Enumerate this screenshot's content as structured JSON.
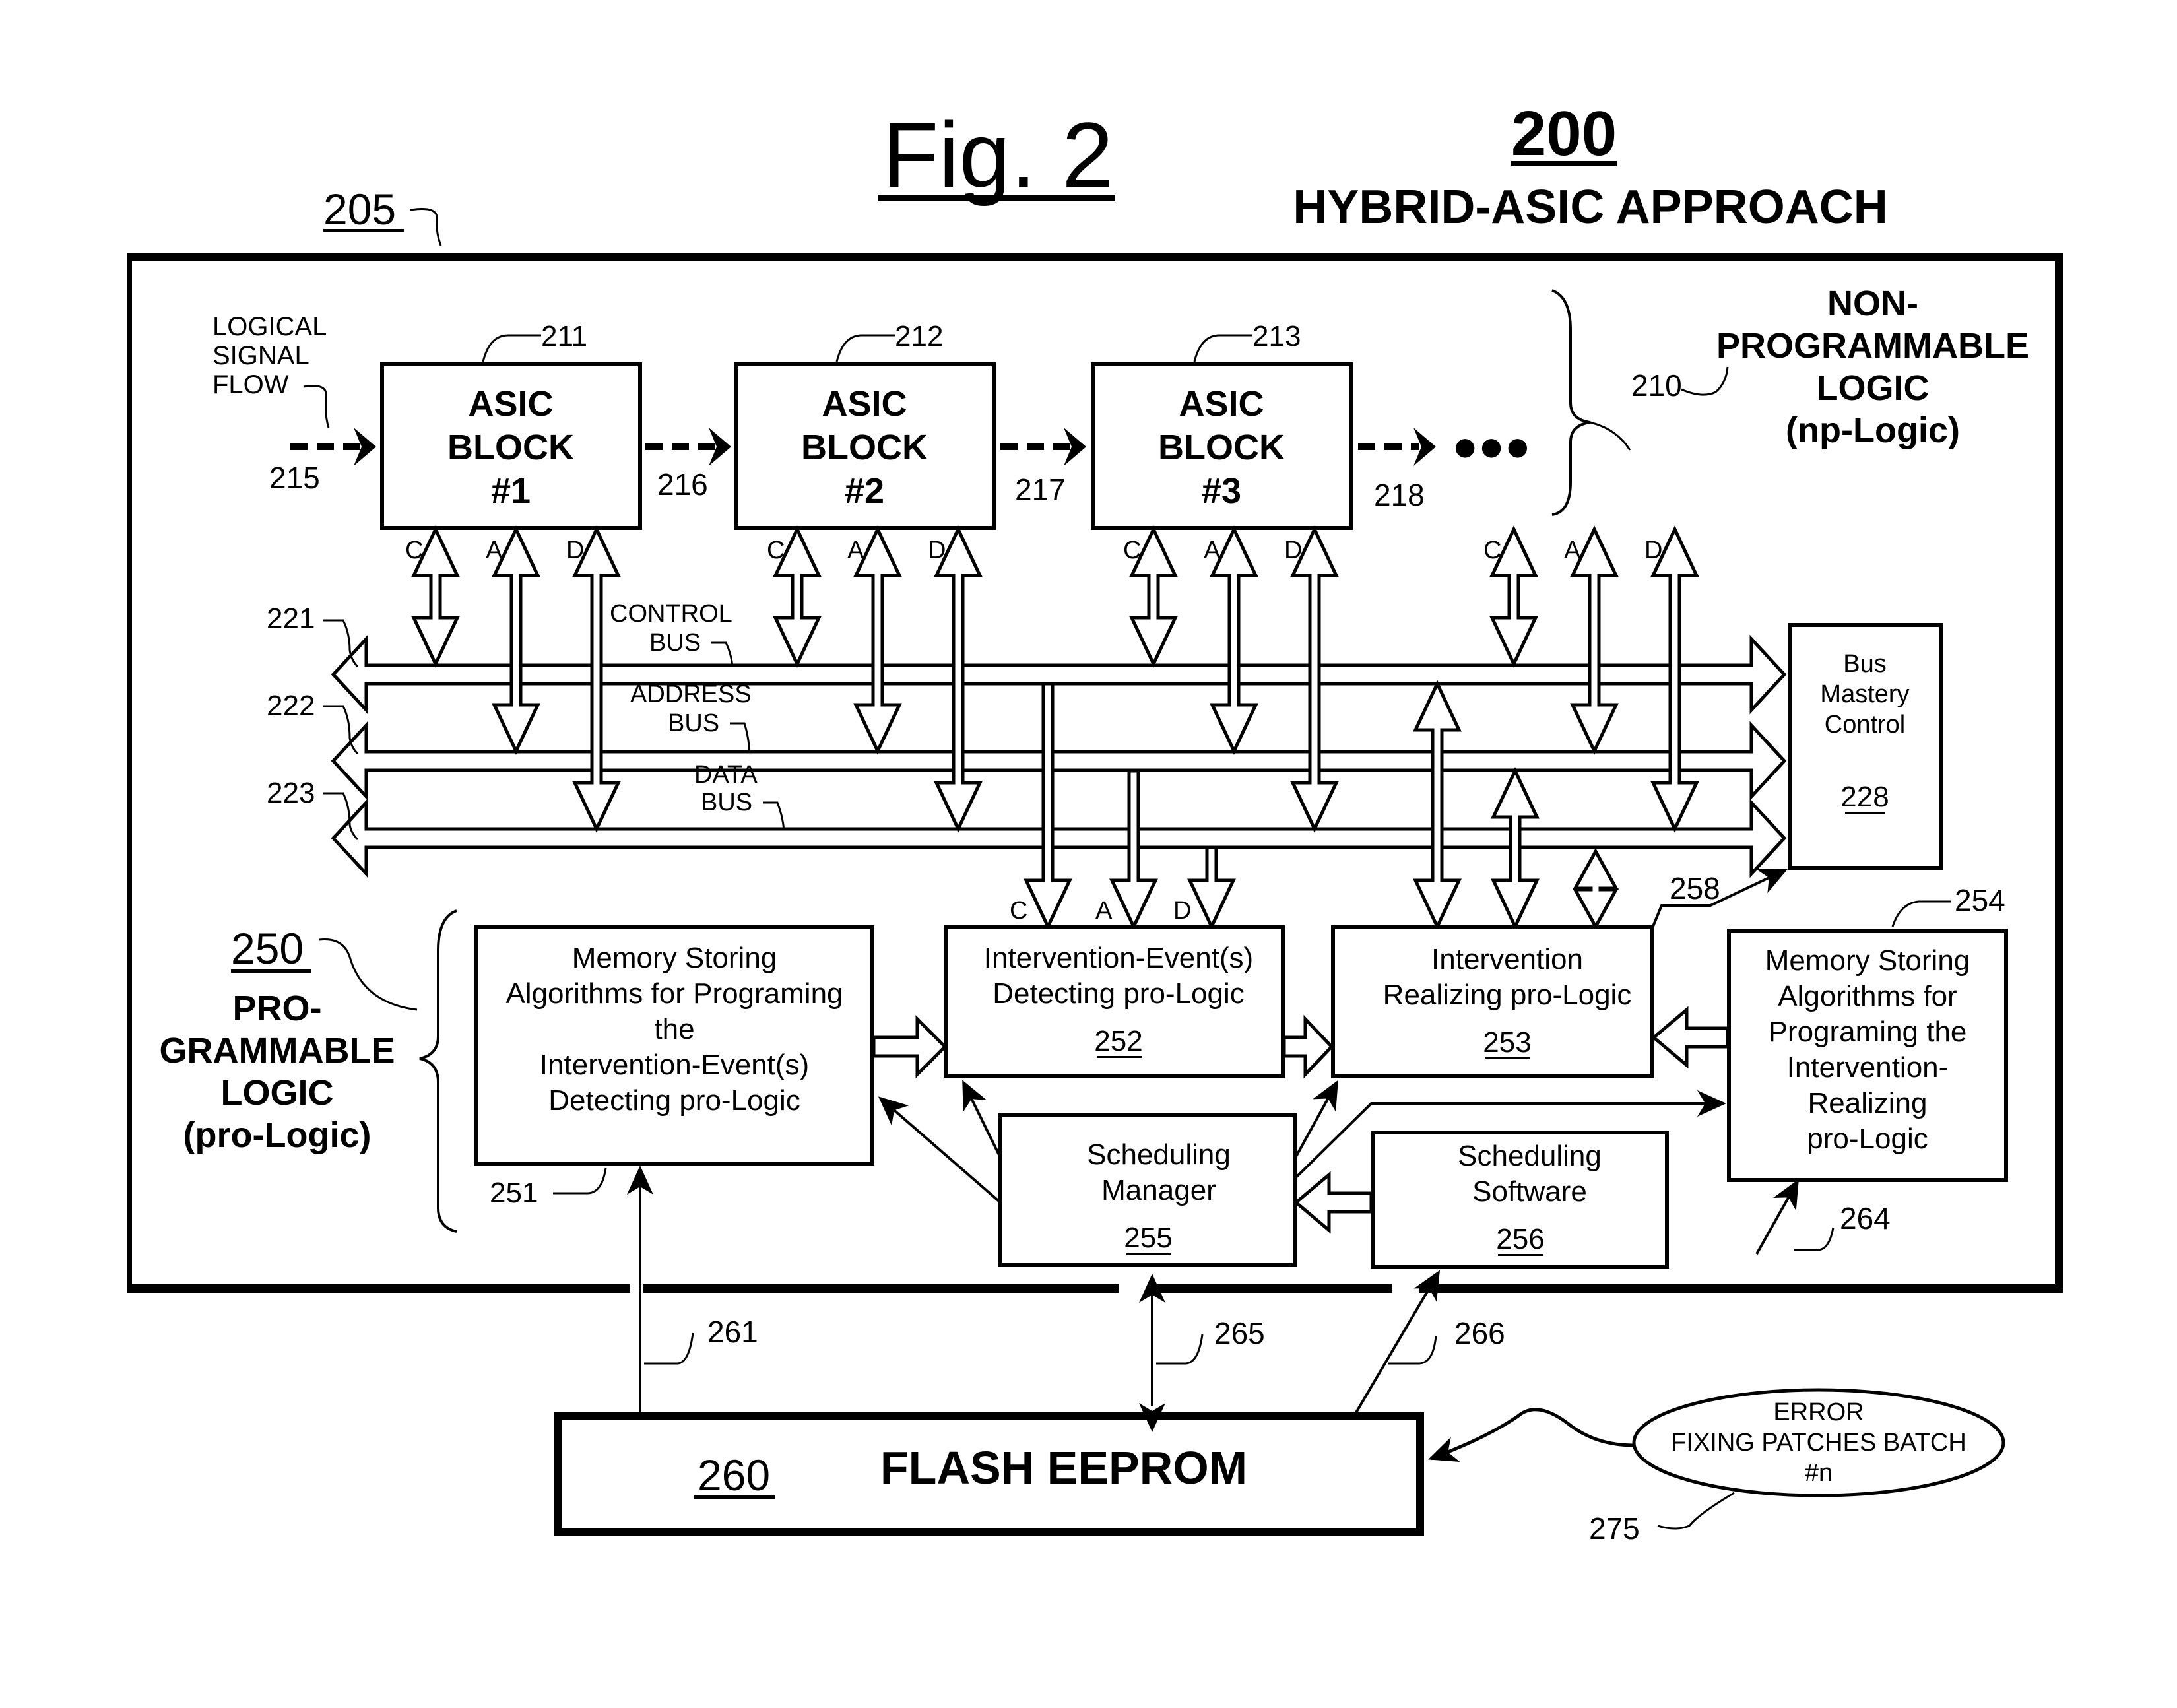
{
  "figure": {
    "title": "Fig. 2",
    "ref_number": "200",
    "subtitle": "HYBRID-ASIC APPROACH",
    "frame_ref": "205"
  },
  "np_logic": {
    "ref": "210",
    "label_lines": [
      "NON-",
      "PROGRAMMABLE",
      "LOGIC",
      "(np-Logic)"
    ],
    "signal_flow_label": [
      "LOGICAL",
      "SIGNAL",
      "FLOW"
    ],
    "flow_refs": [
      "215",
      "216",
      "217",
      "218"
    ],
    "continuation": "●●●",
    "asic_blocks": [
      {
        "ref": "211",
        "lines": [
          "ASIC",
          "BLOCK",
          "#1"
        ]
      },
      {
        "ref": "212",
        "lines": [
          "ASIC",
          "BLOCK",
          "#2"
        ]
      },
      {
        "ref": "213",
        "lines": [
          "ASIC",
          "BLOCK",
          "#3"
        ]
      }
    ],
    "port_letters": [
      "C",
      "A",
      "D"
    ]
  },
  "buses": [
    {
      "ref": "221",
      "label_lines": [
        "CONTROL",
        "BUS"
      ]
    },
    {
      "ref": "222",
      "label_lines": [
        "ADDRESS",
        "BUS"
      ]
    },
    {
      "ref": "223",
      "label_lines": [
        "DATA",
        "BUS"
      ]
    }
  ],
  "bus_mastery": {
    "lines": [
      "Bus",
      "Mastery",
      "Control"
    ],
    "ref": "228"
  },
  "pro_logic": {
    "ref": "250",
    "label_lines": [
      "PRO-",
      "GRAMMABLE",
      "LOGIC",
      "(pro-Logic)"
    ],
    "boxes": {
      "b251": {
        "ref": "251",
        "lines": [
          "Memory Storing",
          "Algorithms for Programing",
          "the",
          "Intervention-Event(s)",
          "Detecting pro-Logic"
        ]
      },
      "b252": {
        "ref": "252",
        "lines": [
          "Intervention-Event(s)",
          "Detecting pro-Logic"
        ]
      },
      "b253": {
        "ref": "253",
        "lines": [
          "Intervention",
          "Realizing pro-Logic"
        ]
      },
      "b254": {
        "ref": "254",
        "lines": [
          "Memory Storing",
          "Algorithms for",
          "Programing the",
          "Intervention-",
          "Realizing",
          "pro-Logic"
        ]
      },
      "b255": {
        "ref": "255",
        "lines": [
          "Scheduling",
          "Manager"
        ]
      },
      "b256": {
        "ref": "256",
        "lines": [
          "Scheduling",
          "Software"
        ]
      }
    },
    "link_refs": {
      "r258": "258",
      "r264": "264"
    }
  },
  "flash": {
    "ref": "260",
    "label": "FLASH EEPROM",
    "link_refs": [
      "261",
      "265",
      "266"
    ]
  },
  "patches": {
    "ref": "275",
    "lines": [
      "ERROR",
      "FIXING PATCHES BATCH",
      "#n"
    ]
  }
}
